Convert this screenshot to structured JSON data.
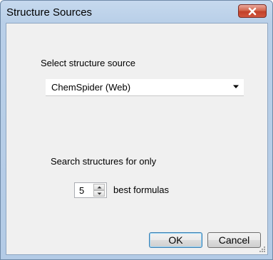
{
  "window": {
    "title": "Structure Sources"
  },
  "source": {
    "label": "Select structure source",
    "selected": "ChemSpider (Web)"
  },
  "search": {
    "label": "Search structures for only",
    "count": "5",
    "suffix": "best formulas"
  },
  "buttons": {
    "ok": "OK",
    "cancel": "Cancel"
  },
  "icons": {
    "close": "close-icon",
    "dropdown": "chevron-down-icon",
    "spin_up": "spin-up-icon",
    "spin_down": "spin-down-icon",
    "grip": "resize-grip-icon"
  },
  "colors": {
    "title_bar": "#b9cfe8",
    "close_button": "#c2412a",
    "client_bg": "#f0f0f0",
    "default_button_border": "#3c7fb1"
  }
}
